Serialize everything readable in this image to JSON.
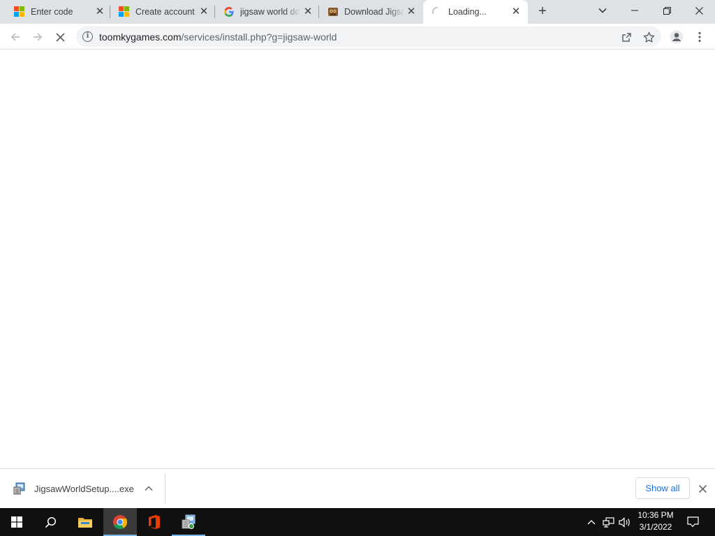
{
  "browser": {
    "tabs": [
      {
        "title": "Enter code",
        "favicon": "microsoft-logo",
        "active": false
      },
      {
        "title": "Create account",
        "favicon": "microsoft-logo",
        "active": false
      },
      {
        "title": "jigsaw world do",
        "favicon": "google-logo",
        "active": false
      },
      {
        "title": "Download Jigsa",
        "favicon": "jigsaw-world-logo",
        "active": false
      },
      {
        "title": "Loading...",
        "favicon": "loading-spinner",
        "active": true
      }
    ],
    "new_tab_label": "+",
    "address": {
      "host": "toomkygames.com",
      "path": "/services/install.php?g=jigsaw-world"
    }
  },
  "download_shelf": {
    "file_name": "JigsawWorldSetup....exe",
    "show_all_label": "Show all"
  },
  "taskbar": {
    "apps": [
      "start",
      "search",
      "file-explorer",
      "chrome",
      "office",
      "installer"
    ],
    "clock": {
      "time": "10:36 PM",
      "date": "3/1/2022"
    }
  },
  "colors": {
    "tabstrip": "#dee1e6",
    "accent": "#1a73e8",
    "taskbar": "#101010"
  }
}
